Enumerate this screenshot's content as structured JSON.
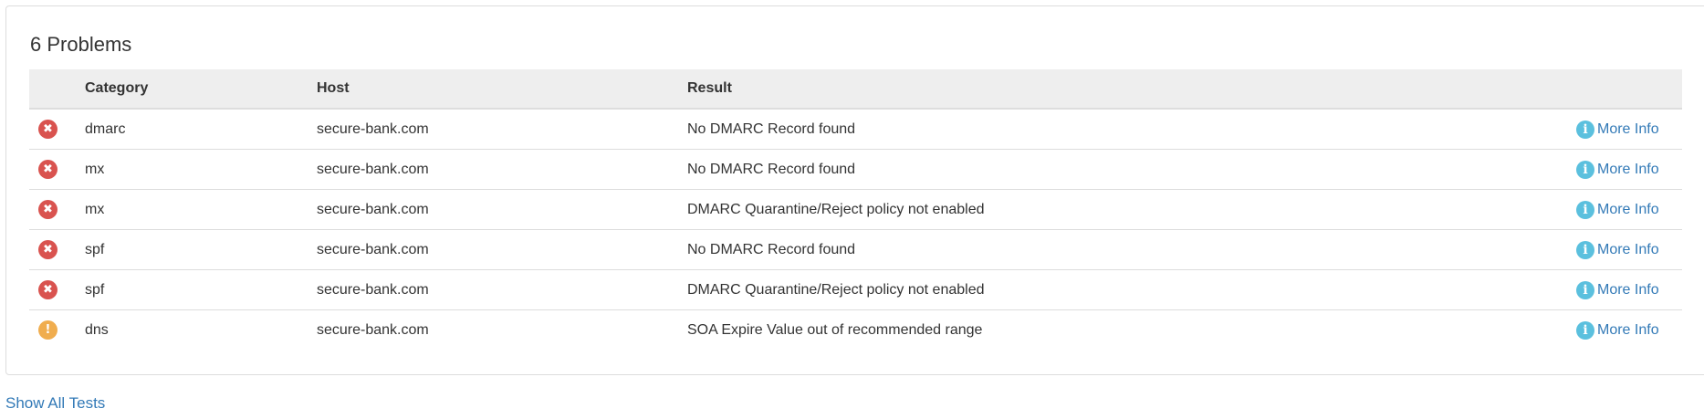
{
  "panel": {
    "title": "6 Problems"
  },
  "table": {
    "headers": {
      "status": "",
      "category": "Category",
      "host": "Host",
      "result": "Result",
      "action": ""
    },
    "rows": [
      {
        "status": "error",
        "status_icon": "x-circle-icon",
        "category": "dmarc",
        "host": "secure-bank.com",
        "result": "No DMARC Record found",
        "action": "More Info"
      },
      {
        "status": "error",
        "status_icon": "x-circle-icon",
        "category": "mx",
        "host": "secure-bank.com",
        "result": "No DMARC Record found",
        "action": "More Info"
      },
      {
        "status": "error",
        "status_icon": "x-circle-icon",
        "category": "mx",
        "host": "secure-bank.com",
        "result": "DMARC Quarantine/Reject policy not enabled",
        "action": "More Info"
      },
      {
        "status": "error",
        "status_icon": "x-circle-icon",
        "category": "spf",
        "host": "secure-bank.com",
        "result": "No DMARC Record found",
        "action": "More Info"
      },
      {
        "status": "error",
        "status_icon": "x-circle-icon",
        "category": "spf",
        "host": "secure-bank.com",
        "result": "DMARC Quarantine/Reject policy not enabled",
        "action": "More Info"
      },
      {
        "status": "warning",
        "status_icon": "exclamation-circle-icon",
        "category": "dns",
        "host": "secure-bank.com",
        "result": "SOA Expire Value out of recommended range",
        "action": "More Info"
      }
    ]
  },
  "footer": {
    "show_all_label": "Show All Tests"
  },
  "colors": {
    "error": "#d9534f",
    "warning": "#f0ad4e",
    "info": "#5bc0de",
    "link": "#337ab7"
  }
}
